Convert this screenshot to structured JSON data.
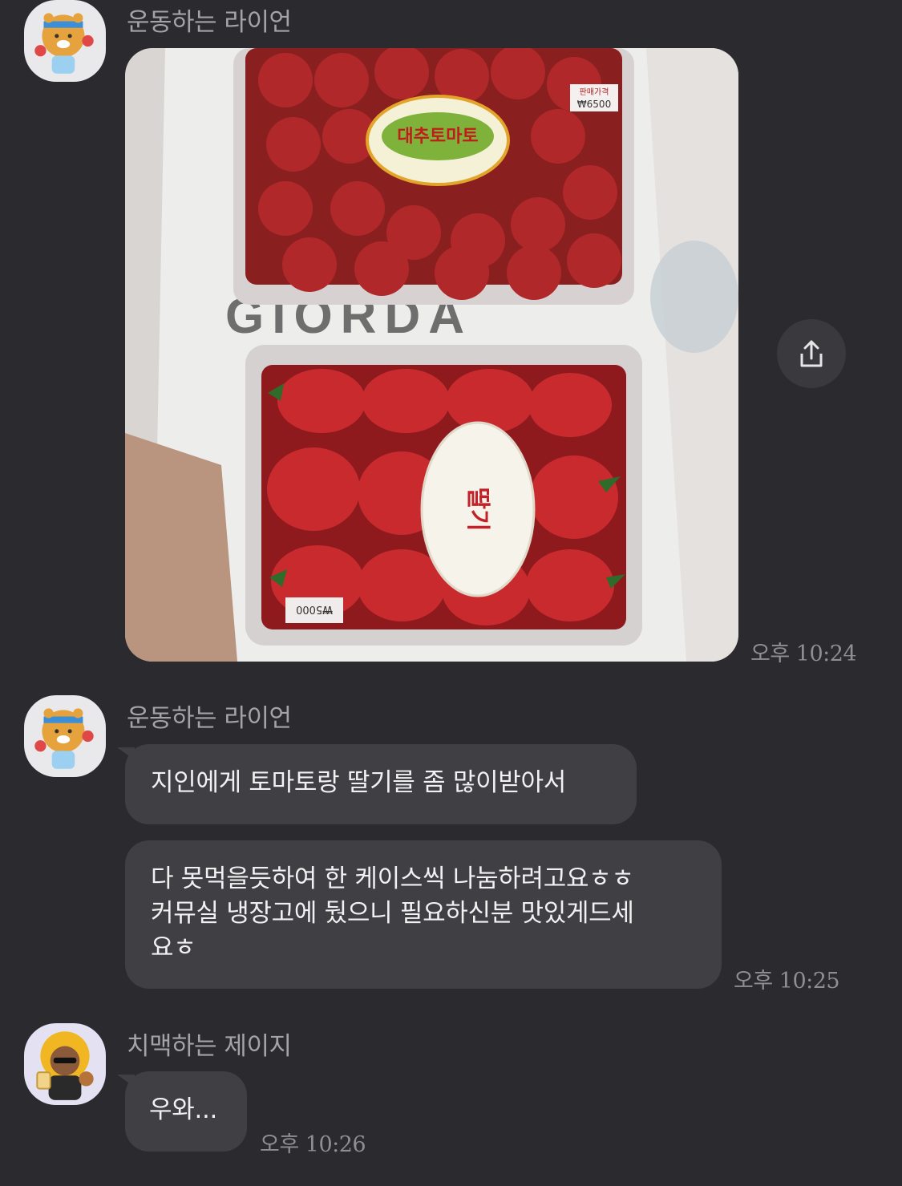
{
  "messages": [
    {
      "sender": "운동하는 라이언",
      "avatar_icon": "ryan-avatar-icon",
      "type": "photo",
      "photo_description_icon": "tomato-strawberry-photo",
      "photo_labels": {
        "tomato_label": "대추토마토",
        "tomato_price": "₩6500",
        "tomato_price_tag": "판매가격",
        "strawberry_label": "딸기",
        "strawberry_price": "₩5000",
        "bag_text": "GIORDA"
      },
      "time": "오후 10:24"
    },
    {
      "sender": "운동하는 라이언",
      "avatar_icon": "ryan-avatar-icon",
      "type": "text",
      "lines": [
        "지인에게 토마토랑 딸기를 좀 많이받아서"
      ]
    },
    {
      "type": "text",
      "lines": [
        "다 못먹을듯하여 한 케이스씩 나눔하려고요ㅎㅎ",
        "커뮤실 냉장고에 뒀으니  필요하신분 맛있게드세",
        "요ㅎ"
      ],
      "time": "오후 10:25"
    },
    {
      "sender": "치맥하는 제이지",
      "avatar_icon": "jayg-avatar-icon",
      "type": "text",
      "lines": [
        "우와..."
      ],
      "time": "오후 10:26"
    }
  ],
  "share_icon": "share-icon",
  "colors": {
    "background": "#2b2a2f",
    "bubble": "#3f3f44",
    "name_text": "#a3a3a8",
    "time_text": "#8e8e93"
  }
}
